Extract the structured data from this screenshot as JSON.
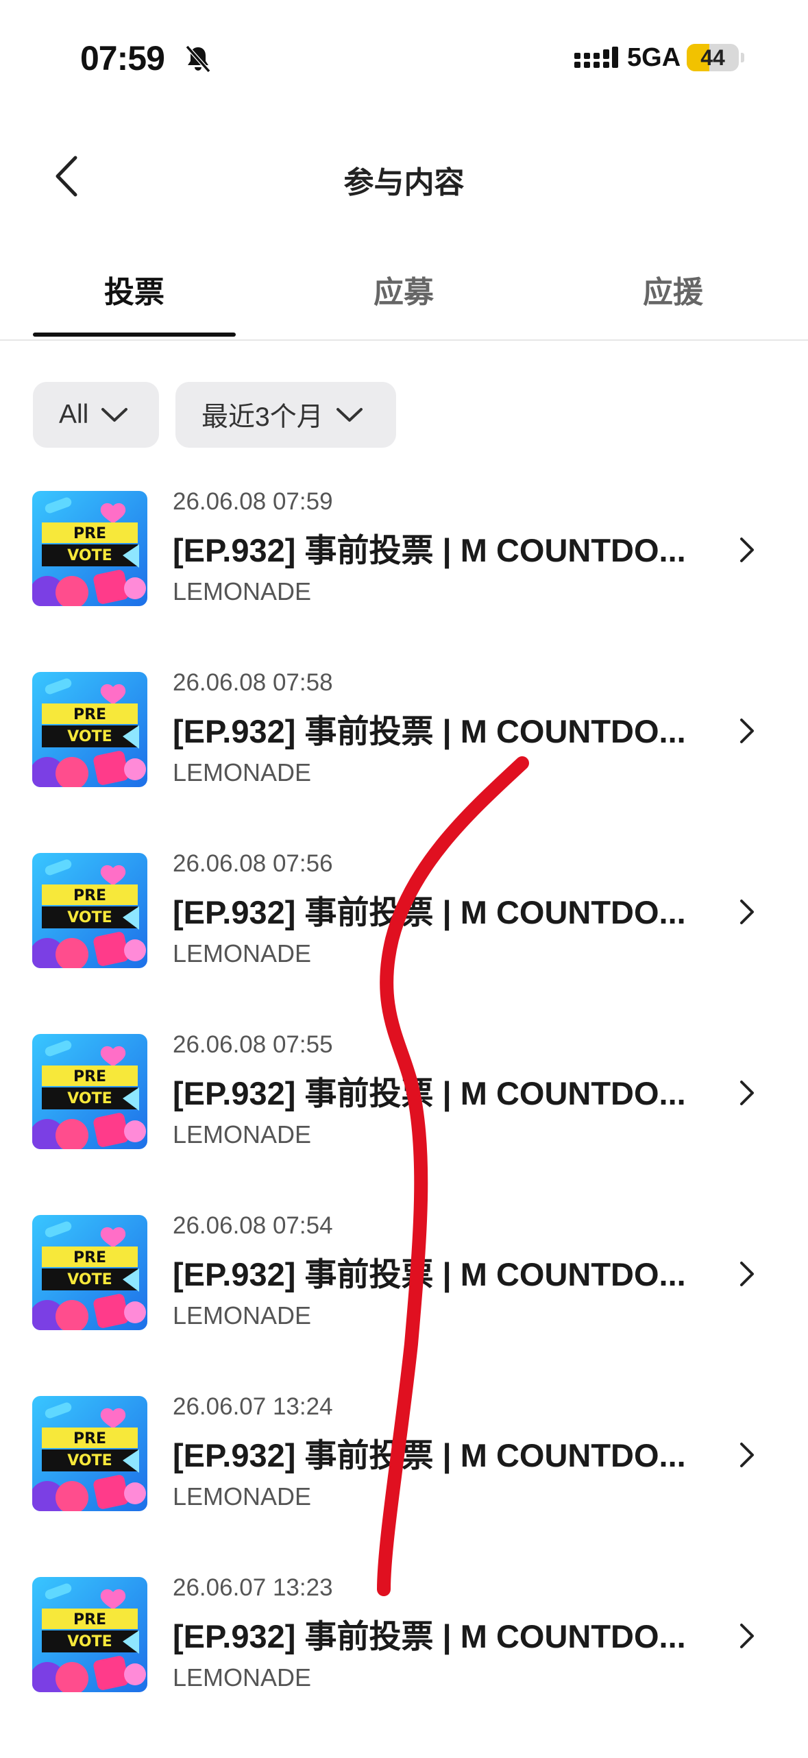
{
  "status_bar": {
    "time": "07:59",
    "network": "5GA",
    "battery": "44",
    "battery_level": 0.44
  },
  "header": {
    "title": "参与内容"
  },
  "tabs": [
    {
      "label": "投票",
      "active": true
    },
    {
      "label": "应募",
      "active": false
    },
    {
      "label": "应援",
      "active": false
    }
  ],
  "filters": {
    "type": "All",
    "period": "最近3个月"
  },
  "thumbnail": {
    "line1": "PRE",
    "line2": "VOTE"
  },
  "items": [
    {
      "date": "26.06.08 07:59",
      "title": "[EP.932] 事前投票 | M COUNTDO...",
      "subtitle": "LEMONADE"
    },
    {
      "date": "26.06.08 07:58",
      "title": "[EP.932] 事前投票 | M COUNTDO...",
      "subtitle": "LEMONADE"
    },
    {
      "date": "26.06.08 07:56",
      "title": "[EP.932] 事前投票 | M COUNTDO...",
      "subtitle": "LEMONADE"
    },
    {
      "date": "26.06.08 07:55",
      "title": "[EP.932] 事前投票 | M COUNTDO...",
      "subtitle": "LEMONADE"
    },
    {
      "date": "26.06.08 07:54",
      "title": "[EP.932] 事前投票 | M COUNTDO...",
      "subtitle": "LEMONADE"
    },
    {
      "date": "26.06.07 13:24",
      "title": "[EP.932] 事前投票 | M COUNTDO...",
      "subtitle": "LEMONADE"
    },
    {
      "date": "26.06.07 13:23",
      "title": "[EP.932] 事前投票 | M COUNTDO...",
      "subtitle": "LEMONADE"
    }
  ],
  "colors": {
    "annotation_stroke": "#e01020",
    "thumb_yellow": "#f7e83a",
    "thumb_blue": "#2a9bf0"
  }
}
